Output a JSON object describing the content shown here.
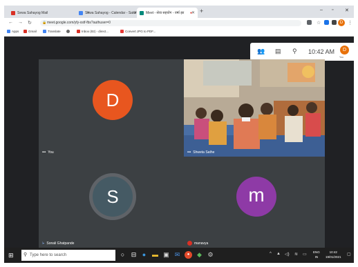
{
  "tabs": [
    {
      "label": "Sewa Sahayog Mail",
      "icon": "gmail-icon",
      "color": "#d93025"
    },
    {
      "label": "Sewa Sahayog - Calendar - Satur",
      "icon": "calendar-icon",
      "color": "#4285f4"
    },
    {
      "label": "Meet - सेवा सहयोग - वर्षा झा",
      "icon": "meet-icon",
      "color": "#00897b"
    }
  ],
  "address": {
    "url": "meet.google.com/yfy-xstf-fbs?authuser=0"
  },
  "bookmarks": [
    {
      "label": "Apps",
      "color": "#4285f4"
    },
    {
      "label": "Gmail",
      "color": "#d93025"
    },
    {
      "label": "Translate",
      "color": "#4285f4"
    },
    {
      "label": "",
      "color": "#666666"
    },
    {
      "label": "Inbox (82) - direct...",
      "color": "#d93025"
    },
    {
      "label": "Convert JPG to PDF...",
      "color": "#e53935"
    }
  ],
  "profile_initial": "D",
  "meet": {
    "time": "10:42 AM",
    "you_label": "You",
    "avatar_initial": "D"
  },
  "tiles": [
    {
      "name": "You",
      "initial": "D",
      "avatar_color": "#e8561f"
    },
    {
      "name": "Shweta Sathe",
      "initial": ""
    },
    {
      "name": "Sonali Ghatpande",
      "initial": "S",
      "avatar_color": "#455a64"
    },
    {
      "name": "manavya",
      "initial": "m",
      "avatar_color": "#8e3aa6"
    }
  ],
  "taskbar": {
    "search_placeholder": "Type here to search",
    "lang_line1": "ENG",
    "lang_line2": "IN",
    "time": "10:42",
    "date": "19/01/2021"
  }
}
